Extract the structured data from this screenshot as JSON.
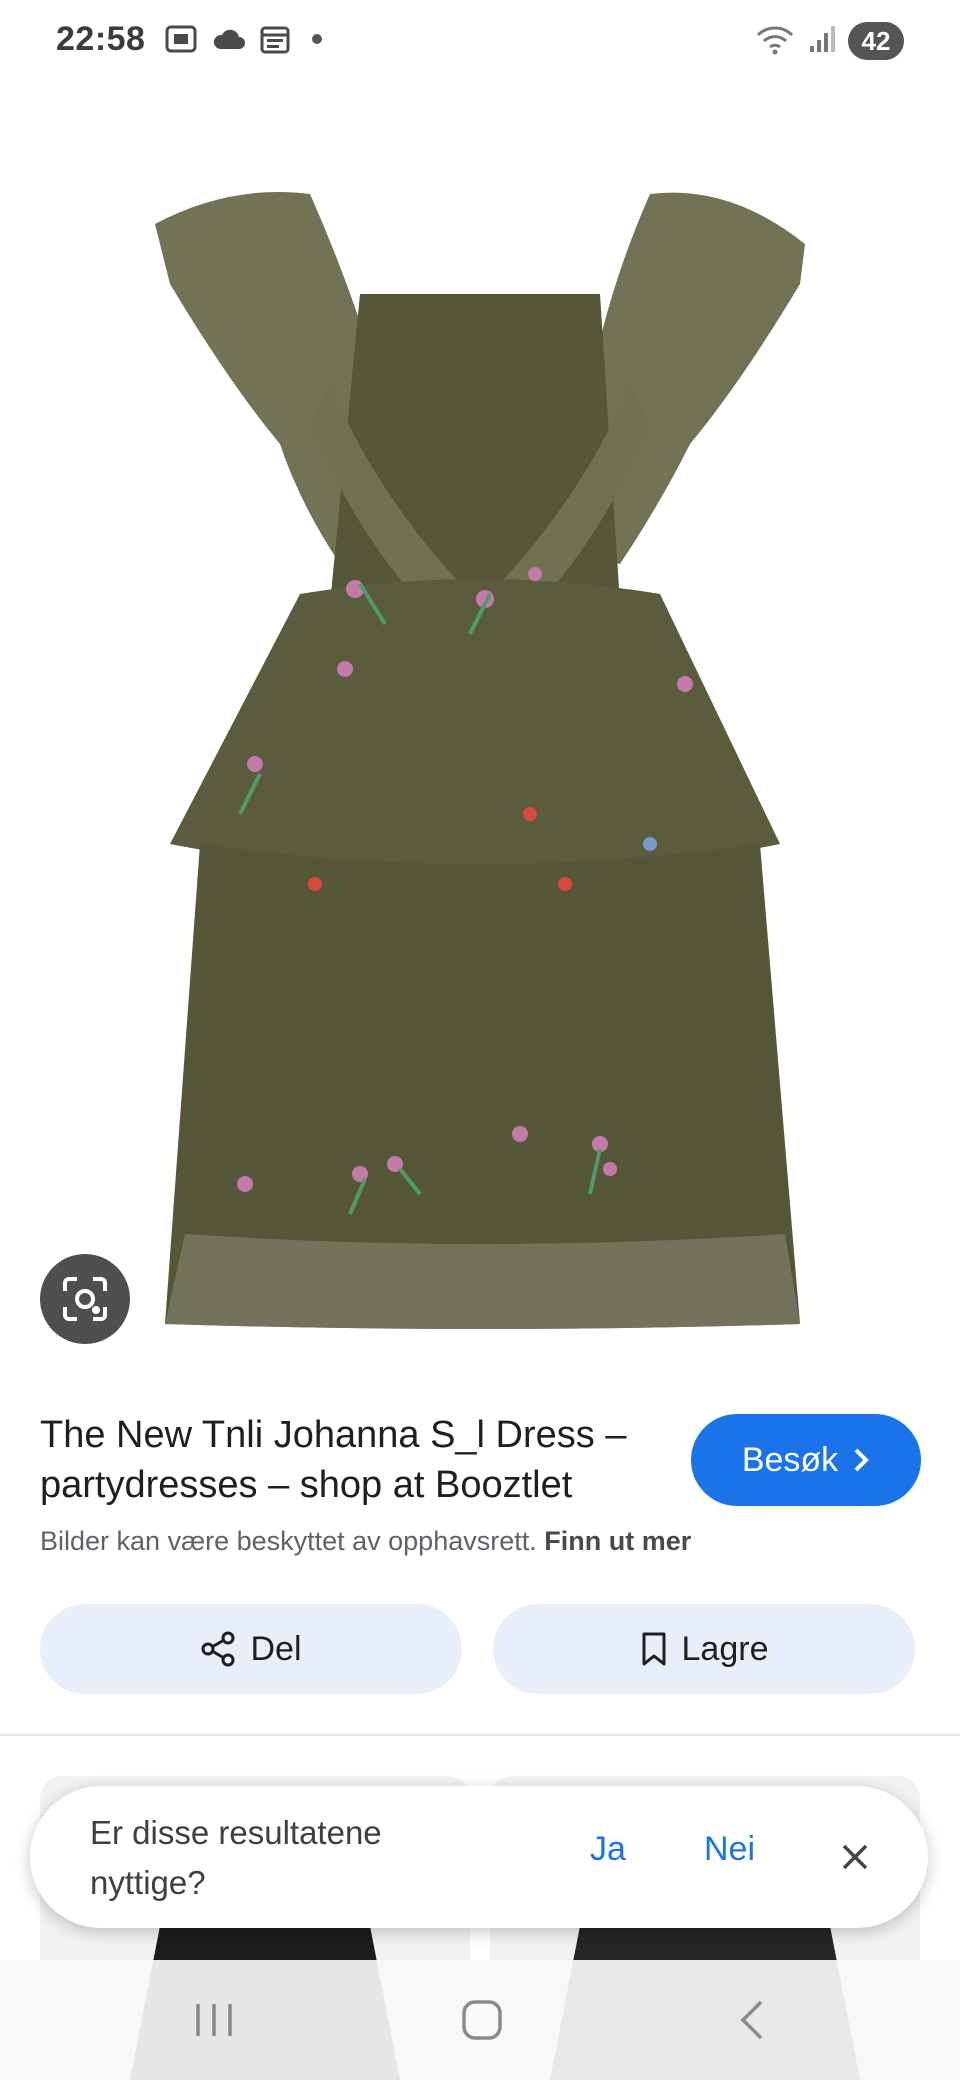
{
  "status_bar": {
    "time": "22:58",
    "left_icons": [
      "screenshot-icon",
      "cloud-icon",
      "calendar-icon",
      "dot-icon"
    ],
    "right_icons": [
      "wifi-icon",
      "signal-icon"
    ],
    "battery": "42"
  },
  "product": {
    "image": {
      "description_icon": "olive-dress-image",
      "dress_color": "#5a5a3e",
      "embroidery_colors": [
        "#c47aa8",
        "#4e9a6a",
        "#d8483c",
        "#7a9bc8"
      ]
    },
    "title": "The New Tnli Johanna S_l Dress – partydresses – shop at Booztlet",
    "visit_label": "Besøk",
    "copyright_text": "Bilder kan være beskyttet av opphavsrett.",
    "learn_more": "Finn ut mer",
    "share_label": "Del",
    "save_label": "Lagre"
  },
  "feedback": {
    "question": "Er disse resultatene nyttige?",
    "yes": "Ja",
    "no": "Nei"
  },
  "colors": {
    "accent": "#1a73e8",
    "action_bg": "#e8effb",
    "lens_bg": "#4f4f4f"
  }
}
